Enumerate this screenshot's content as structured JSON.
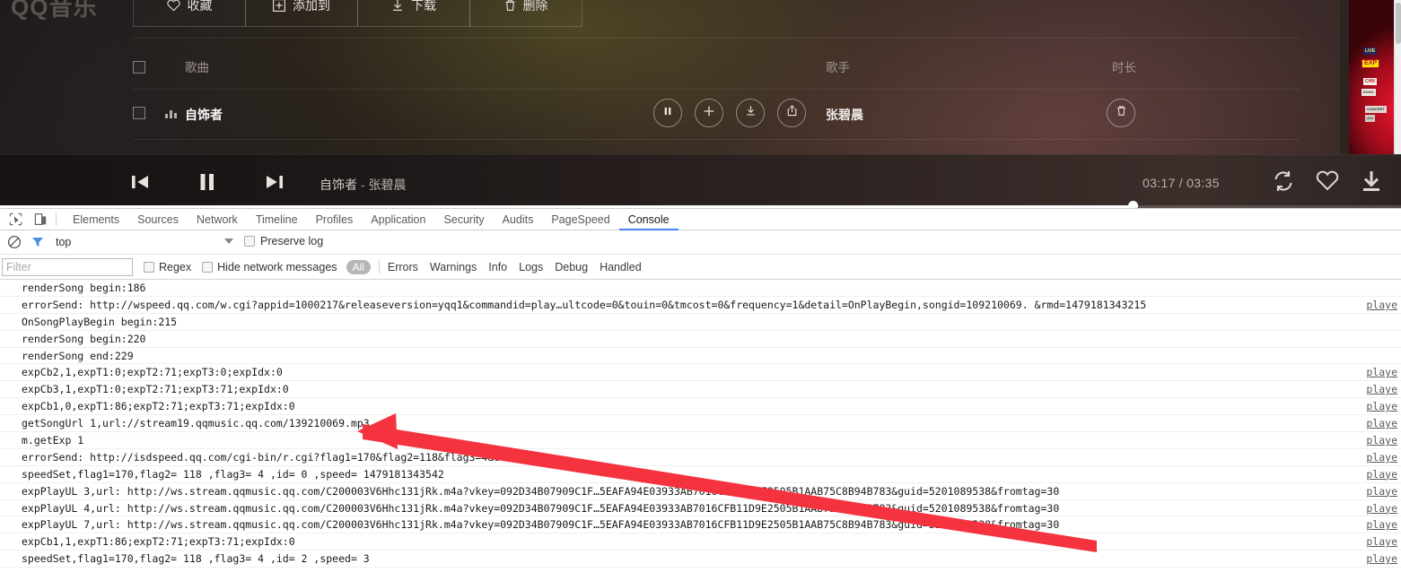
{
  "music": {
    "logo": "QQ音乐",
    "toolbar": [
      {
        "label": "收藏",
        "icon": "heart-icon"
      },
      {
        "label": "添加到",
        "icon": "plus-square-icon"
      },
      {
        "label": "下载",
        "icon": "download-icon"
      },
      {
        "label": "删除",
        "icon": "trash-icon"
      }
    ],
    "columns": {
      "song": "歌曲",
      "artist": "歌手",
      "duration": "时长"
    },
    "row": {
      "title": "自饰者",
      "artist": "张碧晨",
      "actions": [
        "pause-icon",
        "plus-icon",
        "download-icon",
        "share-icon"
      ],
      "delete_icon": "trash-icon"
    },
    "player": {
      "prev_icon": "previous-icon",
      "play_icon": "pause-icon",
      "next_icon": "next-icon",
      "now_playing_title": "自饰者",
      "now_playing_dash": " - ",
      "now_playing_artist": "张碧晨",
      "time_current": "03:17",
      "time_sep": " / ",
      "time_total": "03:35",
      "loop_icon": "repeat-icon",
      "love_icon": "heart-icon",
      "download_icon": "download-icon",
      "progress_percent": 81
    }
  },
  "devtools": {
    "left_icons": [
      "inspect-element-icon",
      "device-toolbar-icon"
    ],
    "tabs": [
      {
        "label": "Elements",
        "active": false
      },
      {
        "label": "Sources",
        "active": false
      },
      {
        "label": "Network",
        "active": false
      },
      {
        "label": "Timeline",
        "active": false
      },
      {
        "label": "Profiles",
        "active": false
      },
      {
        "label": "Application",
        "active": false
      },
      {
        "label": "Security",
        "active": false
      },
      {
        "label": "Audits",
        "active": false
      },
      {
        "label": "PageSpeed",
        "active": false
      },
      {
        "label": "Console",
        "active": true
      }
    ],
    "context_bar": {
      "clear_icon": "clear-console-icon",
      "filter_icon": "funnel-icon",
      "context_value": "top",
      "caret_icon": "chevron-down-icon",
      "preserve_log_label": "Preserve log",
      "preserve_log_checked": false
    },
    "filter_bar": {
      "filter_placeholder": "Filter",
      "filter_value": "",
      "regex_label": "Regex",
      "regex_checked": false,
      "hide_network_label": "Hide network messages",
      "hide_network_checked": false,
      "level_all": "All",
      "levels": [
        "Errors",
        "Warnings",
        "Info",
        "Logs",
        "Debug",
        "Handled"
      ]
    },
    "source_link": "playe",
    "messages": [
      {
        "text": "renderSong begin:186",
        "link": ""
      },
      {
        "text": "errorSend:  http://wspeed.qq.com/w.cgi?appid=1000217&releaseversion=yqq1&commandid=play…ultcode=0&touin=0&tmcost=0&frequency=1&detail=OnPlayBegin,songid=109210069. &rmd=1479181343215",
        "link": "playe"
      },
      {
        "text": "OnSongPlayBegin begin:215",
        "link": ""
      },
      {
        "text": "renderSong begin:220",
        "link": ""
      },
      {
        "text": "renderSong end:229",
        "link": ""
      },
      {
        "text": "expCb2,1,expT1:0;expT2:71;expT3:0;expIdx:0",
        "link": "playe"
      },
      {
        "text": "expCb3,1,expT1:0;expT2:71;expT3:71;expIdx:0",
        "link": "playe"
      },
      {
        "text": "expCb1,0,expT1:86;expT2:71;expT3:71;expIdx:0",
        "link": "playe"
      },
      {
        "text": "getSongUrl 1,url://stream19.qqmusic.qq.com/139210069.mp3",
        "link": "playe"
      },
      {
        "text": "m.getExp 1",
        "link": "playe"
      },
      {
        "text": "errorSend:  http://isdspeed.qq.com/cgi-bin/r.cgi?flag1=170&flag2=118&flag3=4&6=100",
        "link": "playe"
      },
      {
        "text": "speedSet,flag1=170,flag2=  118 ,flag3= 4   ,id=   0   ,speed= 1479181343542",
        "link": "playe"
      },
      {
        "text": "expPlayUL 3,url:    http://ws.stream.qqmusic.qq.com/C200003V6Hhc131jRk.m4a?vkey=092D34B07909C1F…5EAFA94E03933AB7016CFB11D9E2505B1AAB75C8B94B783&guid=5201089538&fromtag=30",
        "link": "playe"
      },
      {
        "text": "expPlayUL 4,url:    http://ws.stream.qqmusic.qq.com/C200003V6Hhc131jRk.m4a?vkey=092D34B07909C1F…5EAFA94E03933AB7016CFB11D9E2505B1AAB75C8B94B783&guid=5201089538&fromtag=30",
        "link": "playe"
      },
      {
        "text": "expPlayUL 7,url:    http://ws.stream.qqmusic.qq.com/C200003V6Hhc131jRk.m4a?vkey=092D34B07909C1F…5EAFA94E03933AB7016CFB11D9E2505B1AAB75C8B94B783&guid=5201089538&fromtag=30",
        "link": "playe"
      },
      {
        "text": "expCb1,1,expT1:86;expT2:71;expT3:71;expIdx:0",
        "link": "playe"
      },
      {
        "text": "speedSet,flag1=170,flag2=  118 ,flag3= 4   ,id=   2   ,speed= 3",
        "link": "playe"
      }
    ]
  },
  "annotation": {
    "arrow_color": "#f5333f",
    "points_to": "getSongUrl 1,url://stream19.qqmusic.qq.com/139210069.mp3"
  }
}
